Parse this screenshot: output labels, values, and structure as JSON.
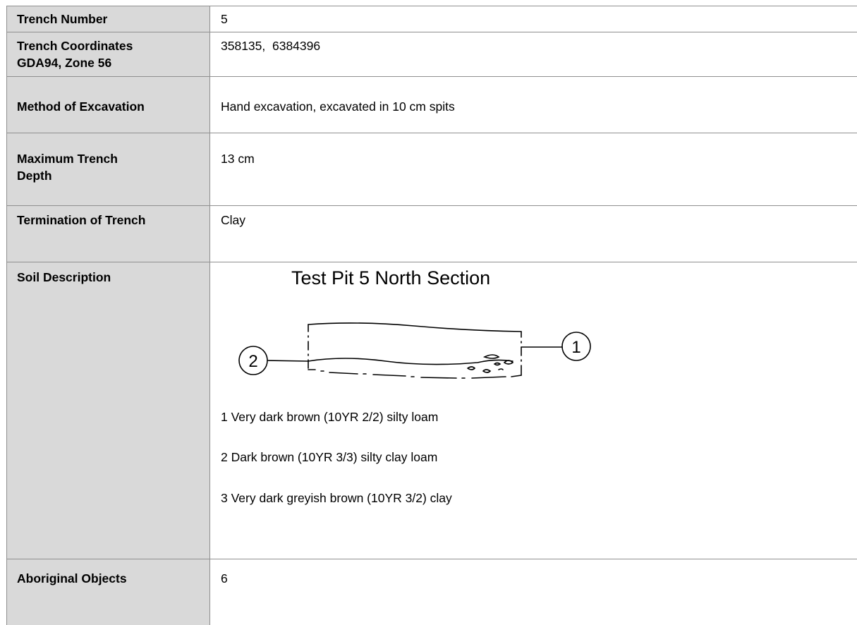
{
  "rows": {
    "trench_number": {
      "label": "Trench Number",
      "value": "5"
    },
    "coordinates": {
      "label_line1": "Trench Coordinates",
      "label_line2": "GDA94, Zone 56",
      "value": "358135,  6384396"
    },
    "method": {
      "label": "Method of Excavation",
      "value": "Hand excavation, excavated in 10 cm spits"
    },
    "max_depth": {
      "label_line1": "Maximum Trench",
      "label_line2": "Depth",
      "value": "13 cm"
    },
    "termination": {
      "label": "Termination of Trench",
      "value": "Clay"
    },
    "soil": {
      "label": "Soil Description",
      "section_title": "Test Pit 5 North Section",
      "marker_1": "1",
      "marker_2": "2",
      "layers": [
        "1 Very dark brown (10YR 2/2) silty loam",
        "2 Dark brown (10YR 3/3) silty clay loam",
        "3 Very dark greyish brown (10YR 3/2) clay"
      ]
    },
    "objects": {
      "label": "Aboriginal Objects",
      "value": "6"
    }
  }
}
